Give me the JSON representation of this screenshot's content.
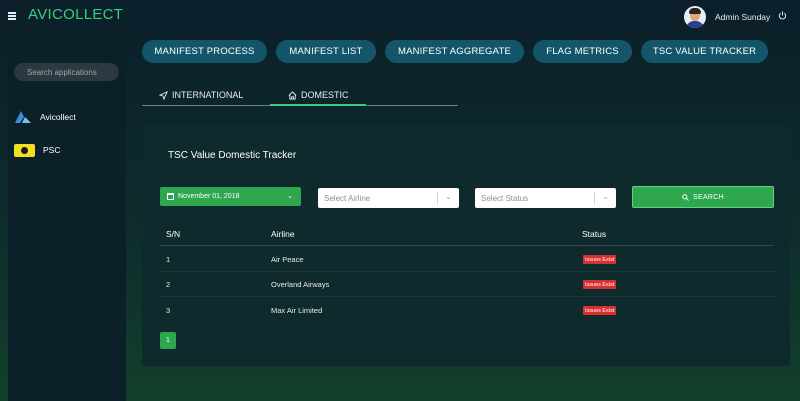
{
  "header": {
    "app_title": "AVICOLLECT",
    "user_name": "Admin Sunday"
  },
  "sidebar": {
    "search_placeholder": "Search applications",
    "items": [
      {
        "label": "Avicollect",
        "icon": "avicollect-logo-icon"
      },
      {
        "label": "PSC",
        "icon": "psc-logo-icon"
      }
    ]
  },
  "nav": {
    "pills": [
      {
        "label": "MANIFEST PROCESS"
      },
      {
        "label": "MANIFEST LIST"
      },
      {
        "label": "MANIFEST AGGREGATE"
      },
      {
        "label": "FLAG METRICS"
      },
      {
        "label": "TSC VALUE TRACKER"
      }
    ]
  },
  "tabs": [
    {
      "label": "INTERNATIONAL",
      "icon": "navigation-arrow-icon",
      "active": false
    },
    {
      "label": "DOMESTIC",
      "icon": "home-icon",
      "active": true
    }
  ],
  "panel": {
    "title": "TSC Value Domestic Tracker",
    "date_value": "November 01, 2018",
    "airline_placeholder": "Select Airline",
    "status_placeholder": "Select Status",
    "search_label": "SEARCH",
    "columns": [
      "S/N",
      "Airline",
      "Status"
    ],
    "rows": [
      {
        "sn": "1",
        "airline": "Air Peace",
        "status": "Issues Exist"
      },
      {
        "sn": "2",
        "airline": "Overland Airways",
        "status": "Issues Exist"
      },
      {
        "sn": "3",
        "airline": "Max Air Limited",
        "status": "Issues Exist"
      }
    ],
    "current_page": "1"
  },
  "colors": {
    "brand_green": "#35d07a",
    "button_green": "#2fa74e",
    "pill_teal": "#13566a",
    "badge_red": "#d8302f"
  }
}
